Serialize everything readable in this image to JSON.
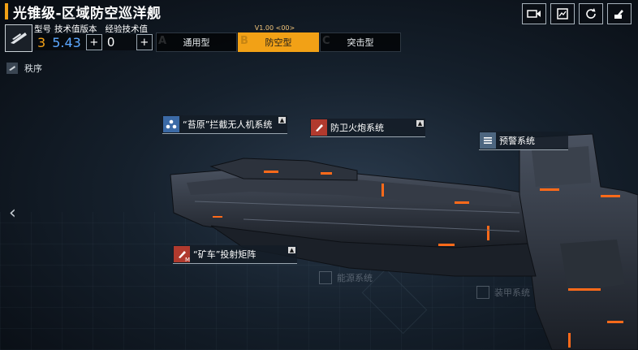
{
  "header": {
    "title": "光锥级-区域防空巡洋舰"
  },
  "top_icons": [
    "video-camera-icon",
    "screenshot-icon",
    "refresh-icon",
    "camera-view-icon"
  ],
  "stats": {
    "labels": [
      "型号",
      "技术值版本",
      "经验技术值"
    ],
    "model": "3",
    "tech_version": "5.43",
    "exp_tech": "0",
    "plus_symbol": "+"
  },
  "version_tag": "V1.00 <00>",
  "tabs": [
    {
      "letter": "A",
      "label": "通用型"
    },
    {
      "letter": "B",
      "label": "防空型"
    },
    {
      "letter": "C",
      "label": "突击型"
    }
  ],
  "order_label": "秩序",
  "back_symbol": "‹",
  "systems": {
    "drone": "“苔原”拦截无人机系统",
    "cannon": "防卫火炮系统",
    "warning": "预警系统",
    "matrix": "“矿车”投射矩阵",
    "matrix_badge": "M",
    "energy": "能源系统",
    "armor": "装甲系统"
  },
  "colors": {
    "accent": "#f2a116",
    "tech_value": "#5da8ff",
    "ship_glow": "#ff6a1a"
  }
}
